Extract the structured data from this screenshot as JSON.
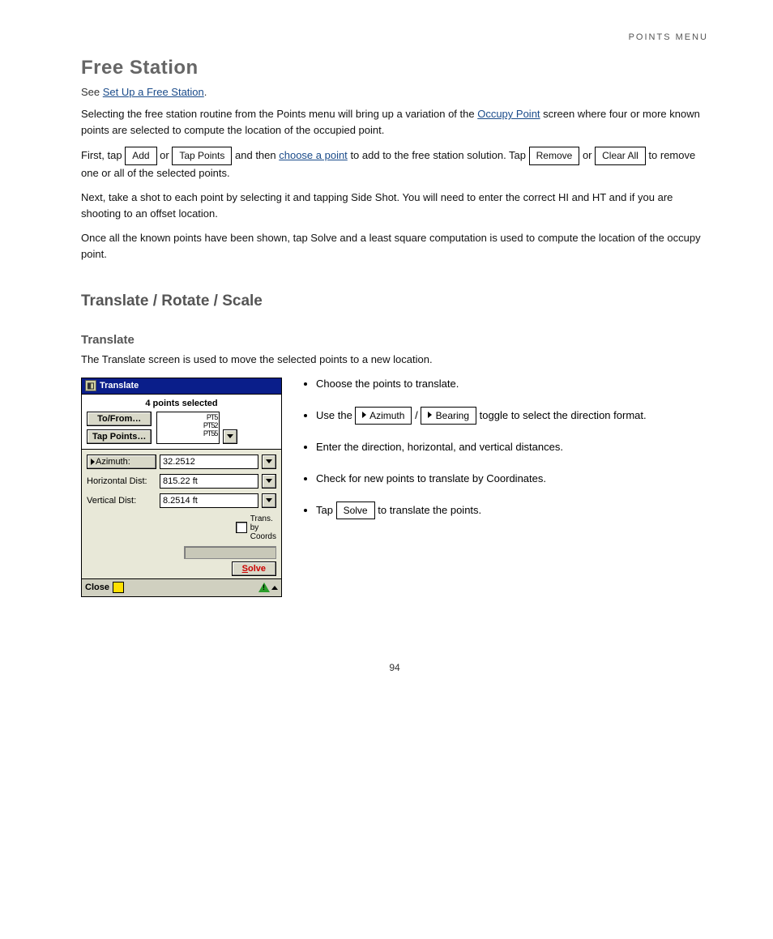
{
  "header": {
    "section_label": "POINTS MENU"
  },
  "section_free_station": {
    "title": "Free Station",
    "subtitle_prefix": "See ",
    "subtitle_link": "Set Up a Free Station",
    "para1_pre": "Selecting the free station routine from the Points menu will bring up a variation of the ",
    "para1_link": "Occupy Point",
    "para1_post": " screen where four or more known points are selected to compute the location of the occupied point.",
    "para2_a": "First, tap ",
    "para2_btn1": "Add",
    "para2_b": " or ",
    "para2_btn2": "Tap Points",
    "para2_c": " and then ",
    "para2_link": "choose a point",
    "para2_d": " to add to the free station solution. Tap ",
    "para2_btn3": "Remove",
    "para2_e": " or ",
    "para2_btn4": "Clear All",
    "para2_f": " to remove one or all of the selected points.",
    "para3": "Next, take a shot to each point by selecting it and tapping Side Shot. You will need to enter the correct HI and HT and if you are shooting to an offset location.",
    "para4": "Once all the known points have been shown, tap Solve and a least square computation is used to compute the location of the occupy point."
  },
  "section_translate": {
    "title": "Translate / Rotate / Scale",
    "heading": "Translate",
    "intro": "The Translate screen is used to move the selected points to a new location.",
    "bullet1": "Choose the points to translate.",
    "bullet2_a": "Use the ",
    "bullet2_btn1": "Azimuth",
    "bullet2_b": " / ",
    "bullet2_btn2": "Bearing",
    "bullet2_c": " toggle to select the direction format.",
    "bullet3": "Enter the direction, horizontal, and vertical distances.",
    "bullet4": "Check for new points to translate by Coordinates.",
    "bullet5_a": "Tap ",
    "bullet5_btn": "Solve",
    "bullet5_b": " to translate the points."
  },
  "app": {
    "title": "Translate",
    "selected_label": "4 points selected",
    "btn_tofrom": "To/From…",
    "btn_tappoints": "Tap Points…",
    "mapline1": "PT5",
    "mapline2": "PT52",
    "mapline3": "PT55",
    "azimuth_label": "Azimuth:",
    "azimuth_value": "32.2512",
    "hdist_label": "Horizontal Dist:",
    "hdist_value": "815.22 ft",
    "vdist_label": "Vertical Dist:",
    "vdist_value": "8.2514 ft",
    "trans_label_l1": "Trans.",
    "trans_label_l2": "by",
    "trans_label_l3": "Coords",
    "solve_label": "Solve",
    "close_label": "Close"
  },
  "footer": "94"
}
